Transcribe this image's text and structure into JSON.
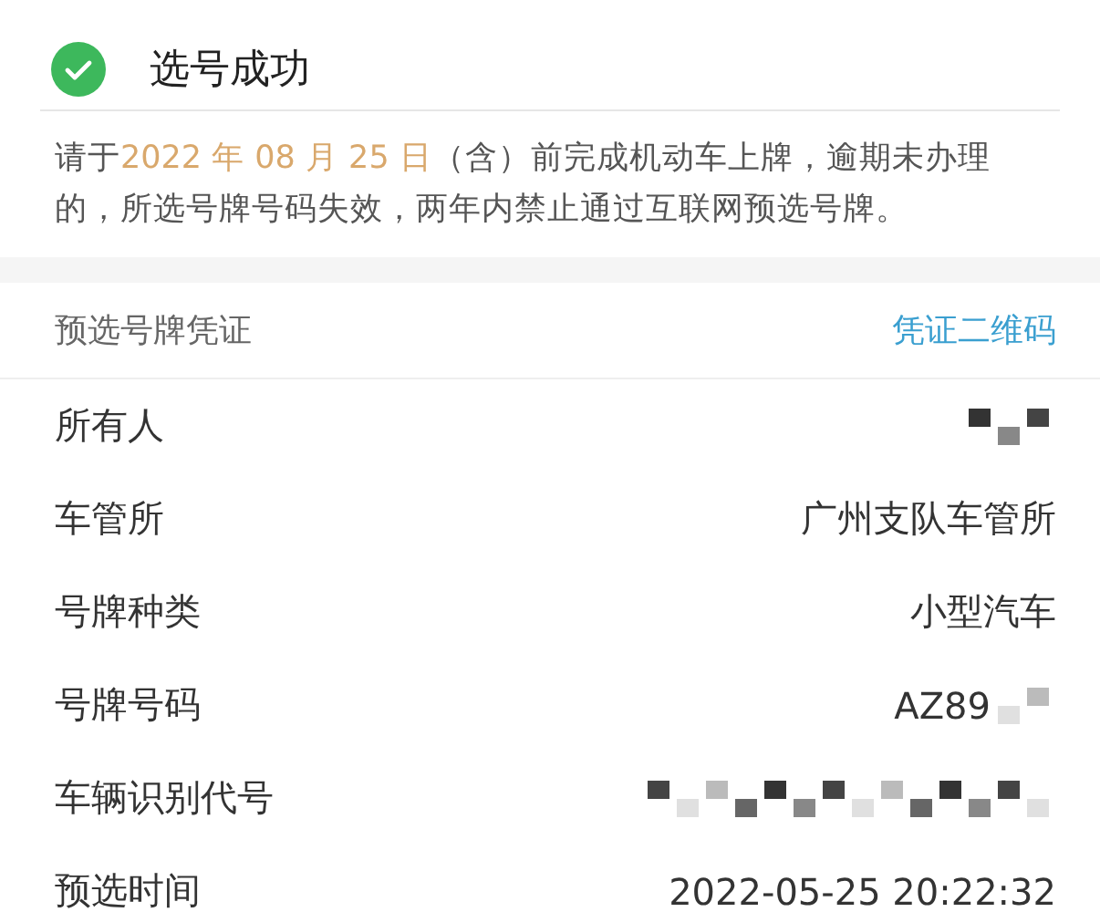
{
  "header": {
    "title": "选号成功"
  },
  "notice": [
    {
      "text": "请于",
      "highlighted": false
    },
    {
      "text": "2022 年 08 月 25 日",
      "highlighted": true
    },
    {
      "text": "（含）前完成机动车上牌，逾期未办理的，所选号牌号码失效，两年内禁止通过互联网预选号牌。",
      "highlighted": false
    }
  ],
  "certificate": {
    "label": "预选号牌凭证",
    "link": "凭证二维码"
  },
  "rows": [
    {
      "label": "所有人",
      "redacted": true
    },
    {
      "label": "车管所",
      "value": "广州支队车管所",
      "redacted": false
    },
    {
      "label": "号牌种类",
      "value": "小型汽车",
      "redacted": false
    },
    {
      "label": "号牌号码",
      "value": "AZ89",
      "redacted": true
    },
    {
      "label": "车辆识别代号",
      "redacted": true
    },
    {
      "label": "预选时间",
      "value": "2022-05-25 20:22:32",
      "redacted": false
    }
  ]
}
